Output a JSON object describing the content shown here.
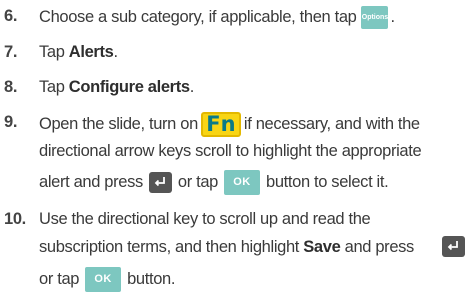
{
  "steps": [
    {
      "number": "6.",
      "lines": [
        {
          "a": "Choose a sub category, if applicable, then tap"
        }
      ]
    },
    {
      "number": "7.",
      "lines": [
        {
          "a": "Tap ",
          "b": "Alerts",
          "c": "."
        }
      ]
    },
    {
      "number": "8.",
      "lines": [
        {
          "a": "Tap ",
          "b": "Configure alerts",
          "c": "."
        }
      ]
    },
    {
      "number": "9.",
      "lines": [
        {
          "a": "Open the slide, turn on",
          "c": "if necessary, and with the"
        },
        {
          "a": "directional arrow keys scroll to highlight the appropriate"
        },
        {
          "a": "alert and press",
          "c": "or tap",
          "d": "button to select it."
        }
      ]
    },
    {
      "number": "10.",
      "lines": [
        {
          "a": "Use the directional key to scroll up and read the"
        },
        {
          "a": "subscription terms, and then highlight ",
          "b": "Save",
          "c": " and press"
        },
        {
          "a": "or tap",
          "c": "button."
        }
      ]
    }
  ],
  "keys": {
    "options": "Options",
    "fn": "Fn",
    "ok": "OK"
  },
  "period": ".",
  "colors": {
    "options_key": "#7dc7c0",
    "fn_key": "#f8d515",
    "fn_text": "#0a7a88",
    "enter_key": "#555555",
    "ok_key": "#7dc7c0"
  }
}
